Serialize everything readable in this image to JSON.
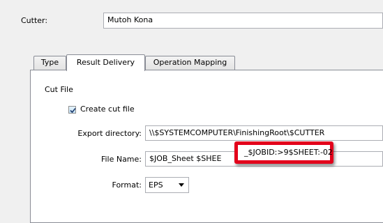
{
  "cutter": {
    "label": "Cutter:",
    "value": "Mutoh Kona"
  },
  "tabs": [
    {
      "label": "Type"
    },
    {
      "label": "Result Delivery"
    },
    {
      "label": "Operation Mapping"
    }
  ],
  "cut_file": {
    "group_label": "Cut File",
    "create_label": "Create cut file",
    "create_checked": true,
    "export_label": "Export directory:",
    "export_value": "\\\\$SYSTEMCOMPUTER\\FinishingRoot\\$CUTTER",
    "filename_label": "File Name:",
    "filename_value": "$JOB_Sheet $SHEE",
    "filename_highlight": "_$JOBID:>9$SHEET:-02",
    "format_label": "Format:",
    "format_value": "EPS"
  },
  "colors": {
    "highlight_border": "#e3001b"
  }
}
